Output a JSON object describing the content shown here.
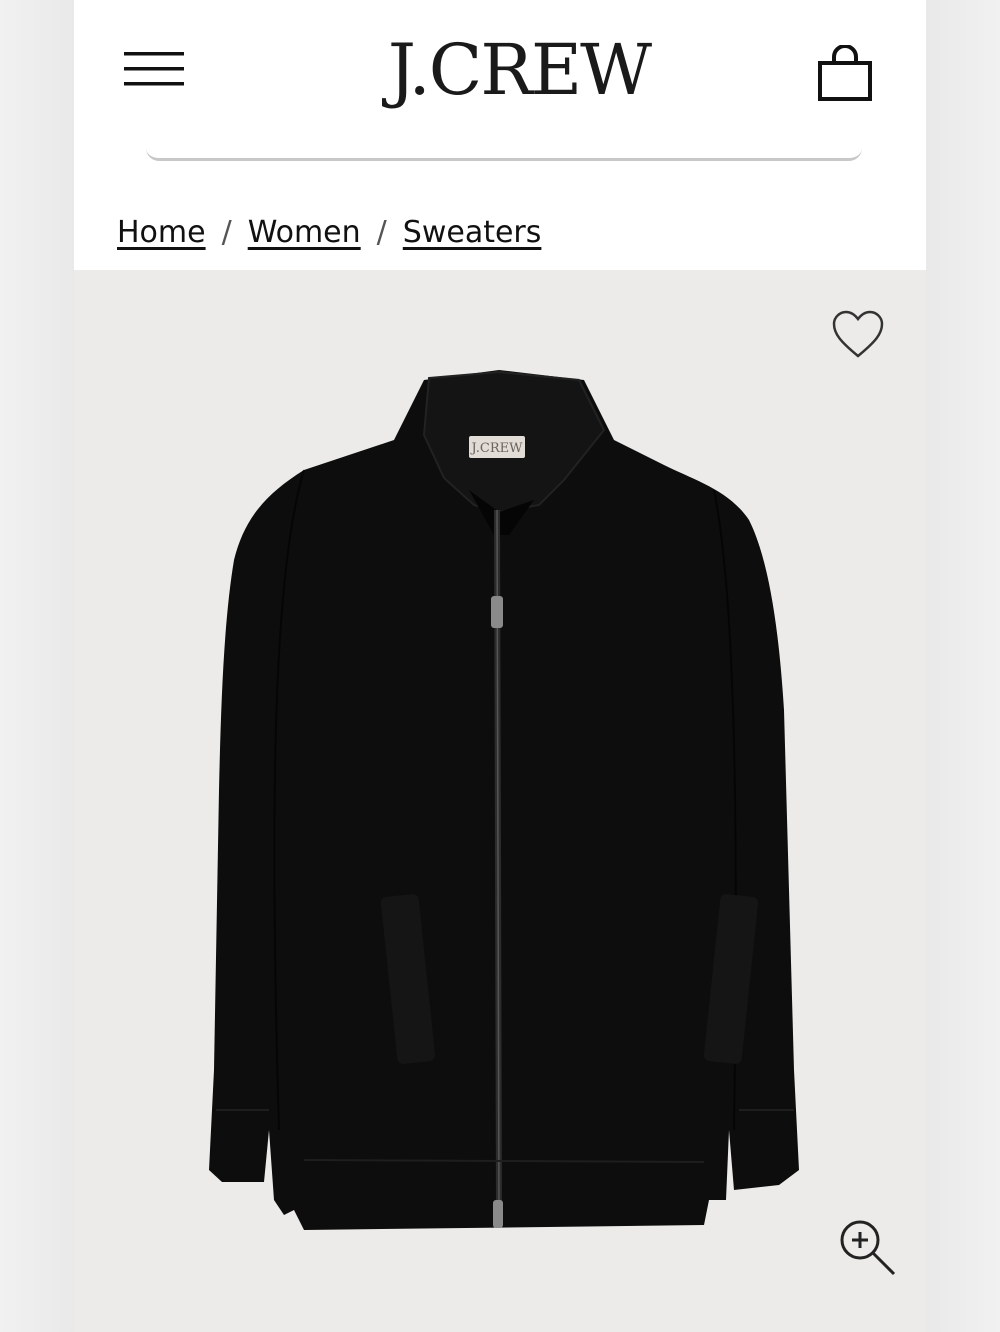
{
  "header": {
    "logo_text": "J.CREW",
    "menu_icon": "hamburger-menu-icon",
    "bag_icon": "shopping-bag-icon"
  },
  "breadcrumb": {
    "items": [
      "Home",
      "Women",
      "Sweaters"
    ],
    "separator": "/"
  },
  "product": {
    "image_description_icon": "product-image",
    "label_text": "J.CREW",
    "wishlist_icon": "heart-icon",
    "zoom_icon": "zoom-in-icon"
  },
  "colors": {
    "background": "#ffffff",
    "product_bg": "#ecebe9",
    "garment": "#0d0d0d",
    "text": "#111111"
  }
}
